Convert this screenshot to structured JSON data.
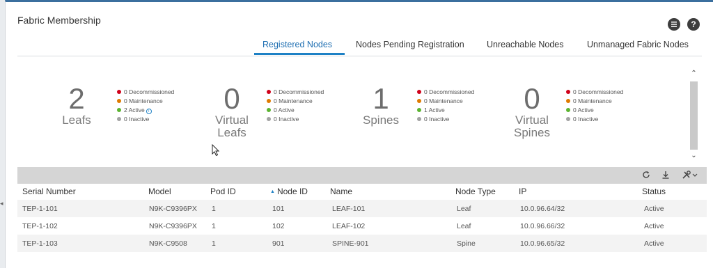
{
  "panel": {
    "title": "Fabric Membership"
  },
  "header_icons": {
    "list": "list-icon",
    "help_label": "?"
  },
  "tabs": [
    {
      "label": "Registered Nodes",
      "active": true
    },
    {
      "label": "Nodes Pending Registration",
      "active": false
    },
    {
      "label": "Unreachable Nodes",
      "active": false
    },
    {
      "label": "Unmanaged Fabric Nodes",
      "active": false
    }
  ],
  "summary": [
    {
      "count": "2",
      "label": "Leafs",
      "label2": "",
      "decommissioned": "0 Decommissioned",
      "maintenance": "0 Maintenance",
      "active": "2 Active",
      "inactive": "0 Inactive",
      "active_info": true
    },
    {
      "count": "0",
      "label": "Virtual",
      "label2": "Leafs",
      "decommissioned": "0 Decommissioned",
      "maintenance": "0 Maintenance",
      "active": "0 Active",
      "inactive": "0 Inactive",
      "active_info": false
    },
    {
      "count": "1",
      "label": "Spines",
      "label2": "",
      "decommissioned": "0 Decommissioned",
      "maintenance": "0 Maintenance",
      "active": "1 Active",
      "inactive": "0 Inactive",
      "active_info": false
    },
    {
      "count": "0",
      "label": "Virtual",
      "label2": "Spines",
      "decommissioned": "0 Decommissioned",
      "maintenance": "0 Maintenance",
      "active": "0 Active",
      "inactive": "0 Inactive",
      "active_info": false
    }
  ],
  "status_colors": {
    "decommissioned": "#d0021b",
    "maintenance": "#e07b00",
    "active": "#5cb531",
    "inactive": "#a3a3a3"
  },
  "toolbar": {
    "refresh": "refresh-icon",
    "download": "download-icon",
    "tools": "tools-icon"
  },
  "table": {
    "columns": {
      "serial": "Serial Number",
      "model": "Model",
      "pod": "Pod ID",
      "node": "Node ID",
      "name": "Name",
      "type": "Node Type",
      "ip": "IP",
      "status": "Status"
    },
    "sort_column": "Node ID",
    "rows": [
      {
        "serial": "TEP-1-101",
        "model": "N9K-C9396PX",
        "pod": "1",
        "node": "101",
        "name": "LEAF-101",
        "type": "Leaf",
        "ip": "10.0.96.64/32",
        "status": "Active"
      },
      {
        "serial": "TEP-1-102",
        "model": "N9K-C9396PX",
        "pod": "1",
        "node": "102",
        "name": "LEAF-102",
        "type": "Leaf",
        "ip": "10.0.96.66/32",
        "status": "Active"
      },
      {
        "serial": "TEP-1-103",
        "model": "N9K-C9508",
        "pod": "1",
        "node": "901",
        "name": "SPINE-901",
        "type": "Spine",
        "ip": "10.0.96.65/32",
        "status": "Active"
      }
    ]
  }
}
